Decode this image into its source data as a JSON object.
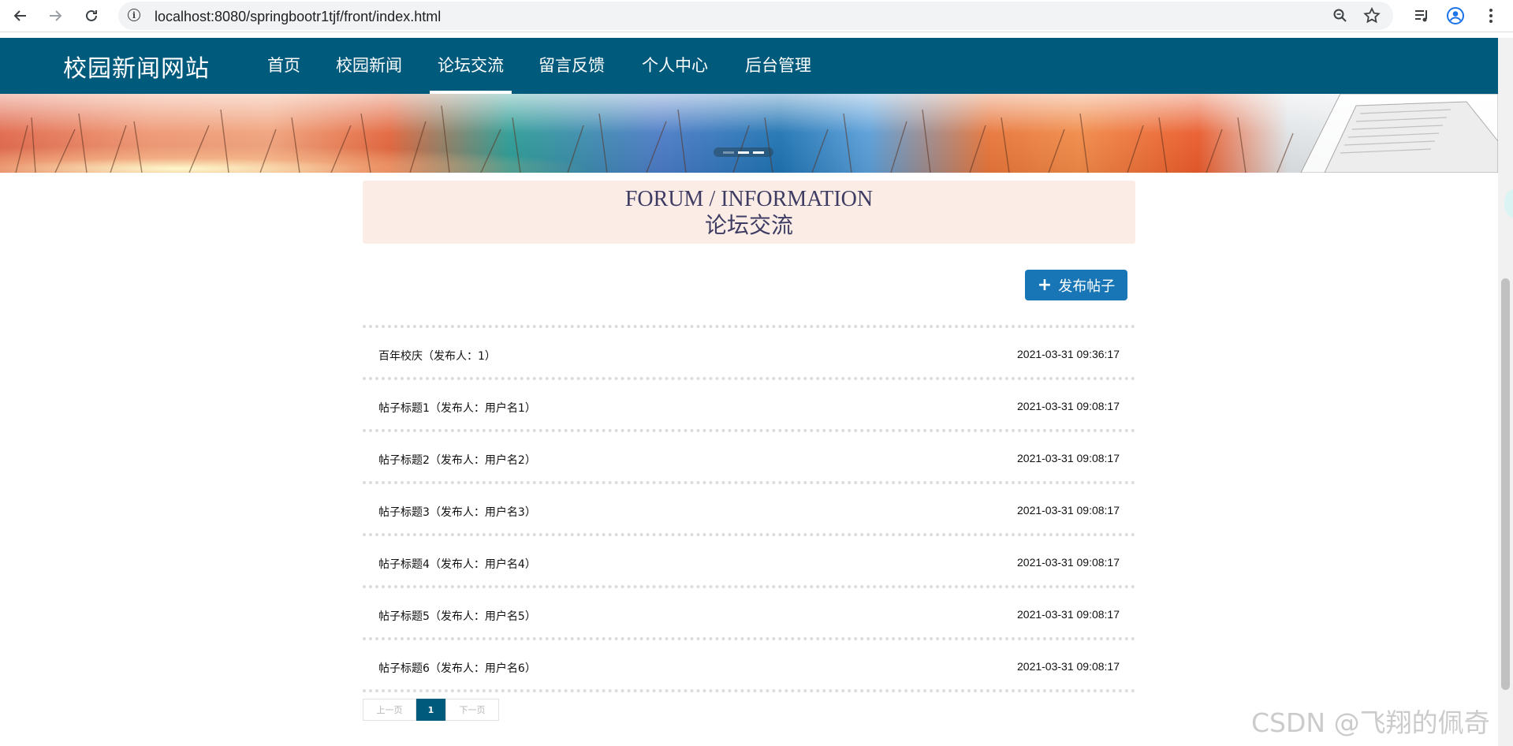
{
  "browser": {
    "url": "localhost:8080/springbootr1tjf/front/index.html"
  },
  "site": {
    "logo": "校园新闻网站",
    "nav": [
      {
        "label": "首页"
      },
      {
        "label": "校园新闻"
      },
      {
        "label": "论坛交流",
        "active": true
      },
      {
        "label": "留言反馈"
      },
      {
        "label": "个人中心"
      },
      {
        "label": "后台管理"
      }
    ]
  },
  "banner": {
    "active_slide": 1,
    "slide_count": 3
  },
  "section": {
    "title_en": "FORUM / INFORMATION",
    "title_cn": "论坛交流"
  },
  "actions": {
    "publish_label": "发布帖子"
  },
  "posts": [
    {
      "title": "百年校庆（发布人：1）",
      "time": "2021-03-31 09:36:17"
    },
    {
      "title": "帖子标题1（发布人：用户名1）",
      "time": "2021-03-31 09:08:17"
    },
    {
      "title": "帖子标题2（发布人：用户名2）",
      "time": "2021-03-31 09:08:17"
    },
    {
      "title": "帖子标题3（发布人：用户名3）",
      "time": "2021-03-31 09:08:17"
    },
    {
      "title": "帖子标题4（发布人：用户名4）",
      "time": "2021-03-31 09:08:17"
    },
    {
      "title": "帖子标题5（发布人：用户名5）",
      "time": "2021-03-31 09:08:17"
    },
    {
      "title": "帖子标题6（发布人：用户名6）",
      "time": "2021-03-31 09:08:17"
    }
  ],
  "pagination": {
    "prev_label": "上一页",
    "current_page": "1",
    "next_label": "下一页"
  },
  "watermark": "CSDN @飞翔的佩奇",
  "colors": {
    "nav_bg": "#005a7c",
    "accent_button": "#1976b6",
    "title_bg": "#fbede6",
    "title_text": "#3e3c63"
  }
}
